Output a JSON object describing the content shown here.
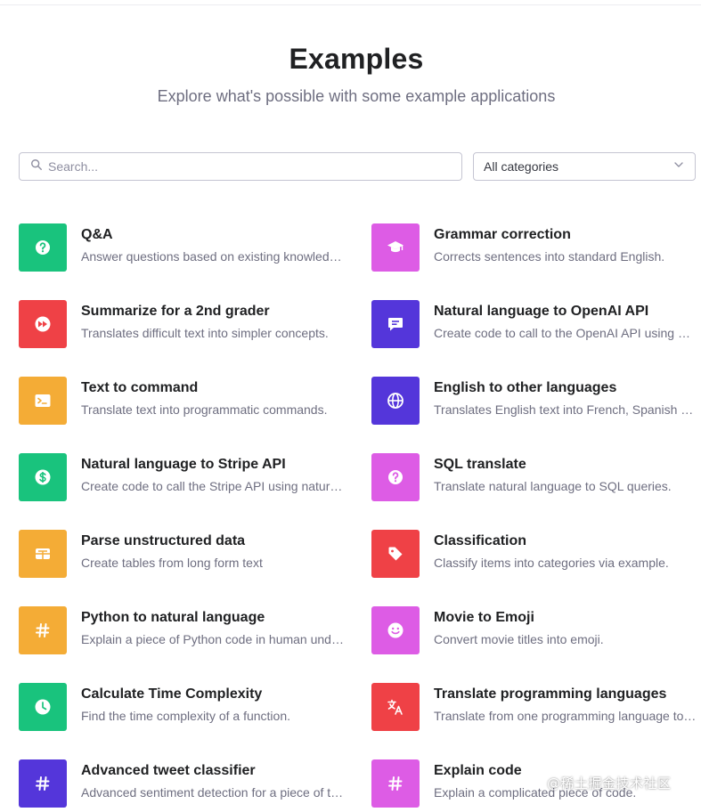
{
  "header": {
    "title": "Examples",
    "subtitle": "Explore what's possible with some example applications"
  },
  "search": {
    "placeholder": "Search...",
    "value": ""
  },
  "category_filter": {
    "selected": "All categories"
  },
  "colors": {
    "green": "#19c37d",
    "red": "#ef4146",
    "orange": "#f4ac36",
    "magenta": "#dd5ce5",
    "purple": "#5436da"
  },
  "examples": [
    {
      "title": "Q&A",
      "description": "Answer questions based on existing knowledge.",
      "icon": "question-icon",
      "color": "green"
    },
    {
      "title": "Grammar correction",
      "description": "Corrects sentences into standard English.",
      "icon": "graduation-cap-icon",
      "color": "magenta"
    },
    {
      "title": "Summarize for a 2nd grader",
      "description": "Translates difficult text into simpler concepts.",
      "icon": "fast-forward-icon",
      "color": "red"
    },
    {
      "title": "Natural language to OpenAI API",
      "description": "Create code to call to the OpenAI API using a natural language instruction.",
      "icon": "chat-bubble-icon",
      "color": "purple"
    },
    {
      "title": "Text to command",
      "description": "Translate text into programmatic commands.",
      "icon": "terminal-icon",
      "color": "orange"
    },
    {
      "title": "English to other languages",
      "description": "Translates English text into French, Spanish and Japanese.",
      "icon": "globe-icon",
      "color": "purple"
    },
    {
      "title": "Natural language to Stripe API",
      "description": "Create code to call the Stripe API using natural language.",
      "icon": "dollar-icon",
      "color": "green"
    },
    {
      "title": "SQL translate",
      "description": "Translate natural language to SQL queries.",
      "icon": "question-icon",
      "color": "magenta"
    },
    {
      "title": "Parse unstructured data",
      "description": "Create tables from long form text",
      "icon": "table-icon",
      "color": "orange"
    },
    {
      "title": "Classification",
      "description": "Classify items into categories via example.",
      "icon": "tag-icon",
      "color": "red"
    },
    {
      "title": "Python to natural language",
      "description": "Explain a piece of Python code in human understandable language.",
      "icon": "hash-icon",
      "color": "orange"
    },
    {
      "title": "Movie to Emoji",
      "description": "Convert movie titles into emoji.",
      "icon": "smiley-icon",
      "color": "magenta"
    },
    {
      "title": "Calculate Time Complexity",
      "description": "Find the time complexity of a function.",
      "icon": "clock-icon",
      "color": "green"
    },
    {
      "title": "Translate programming languages",
      "description": "Translate from one programming language to another.",
      "icon": "translate-icon",
      "color": "red"
    },
    {
      "title": "Advanced tweet classifier",
      "description": "Advanced sentiment detection for a piece of text.",
      "icon": "hash-icon",
      "color": "purple"
    },
    {
      "title": "Explain code",
      "description": "Explain a complicated piece of code.",
      "icon": "hash-icon",
      "color": "magenta"
    }
  ],
  "watermark": "@稀土掘金技术社区"
}
